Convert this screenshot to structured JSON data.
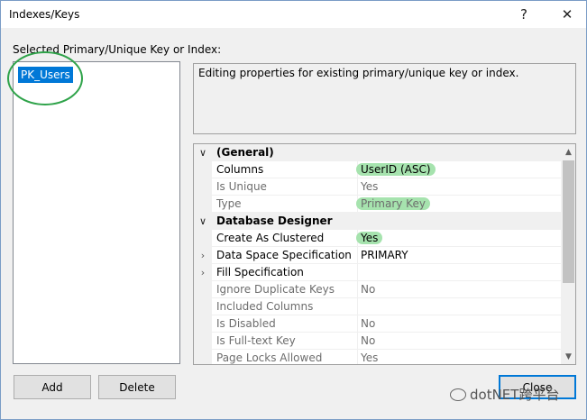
{
  "window": {
    "title": "Indexes/Keys",
    "help_glyph": "?",
    "close_glyph": "✕"
  },
  "left_panel": {
    "label": "Selected Primary/Unique Key or Index:",
    "items": [
      {
        "label": "PK_Users",
        "selected": true
      }
    ]
  },
  "description": "Editing properties for existing primary/unique key or index.",
  "property_grid": {
    "rows": [
      {
        "kind": "category",
        "label": "(General)",
        "expander": "expanded"
      },
      {
        "kind": "property",
        "name": "Columns",
        "value": "UserID (ASC)",
        "highlight": true
      },
      {
        "kind": "property",
        "name": "Is Unique",
        "value": "Yes",
        "readonly": true
      },
      {
        "kind": "property",
        "name": "Type",
        "value": "Primary Key",
        "readonly": true,
        "highlight": true
      },
      {
        "kind": "category",
        "label": "Database Designer",
        "expander": "expanded"
      },
      {
        "kind": "property",
        "name": "Create As Clustered",
        "value": "Yes",
        "highlight": true
      },
      {
        "kind": "property",
        "name": "Data Space Specification",
        "value": "PRIMARY",
        "expander": "collapsed"
      },
      {
        "kind": "property",
        "name": "Fill Specification",
        "value": "",
        "expander": "collapsed"
      },
      {
        "kind": "property",
        "name": "Ignore Duplicate Keys",
        "value": "No",
        "readonly": true
      },
      {
        "kind": "property",
        "name": "Included Columns",
        "value": "",
        "readonly": true
      },
      {
        "kind": "property",
        "name": "Is Disabled",
        "value": "No",
        "readonly": true
      },
      {
        "kind": "property",
        "name": "Is Full-text Key",
        "value": "No",
        "readonly": true
      },
      {
        "kind": "property",
        "name": "Page Locks Allowed",
        "value": "Yes",
        "readonly": true
      }
    ]
  },
  "buttons": {
    "add": "Add",
    "delete": "Delete",
    "close": "Close"
  },
  "watermark": "dotNET跨平台",
  "colors": {
    "selection": "#0078d7",
    "annotation_green": "#2fa34a",
    "highlight_green": "#a6e3ae"
  }
}
